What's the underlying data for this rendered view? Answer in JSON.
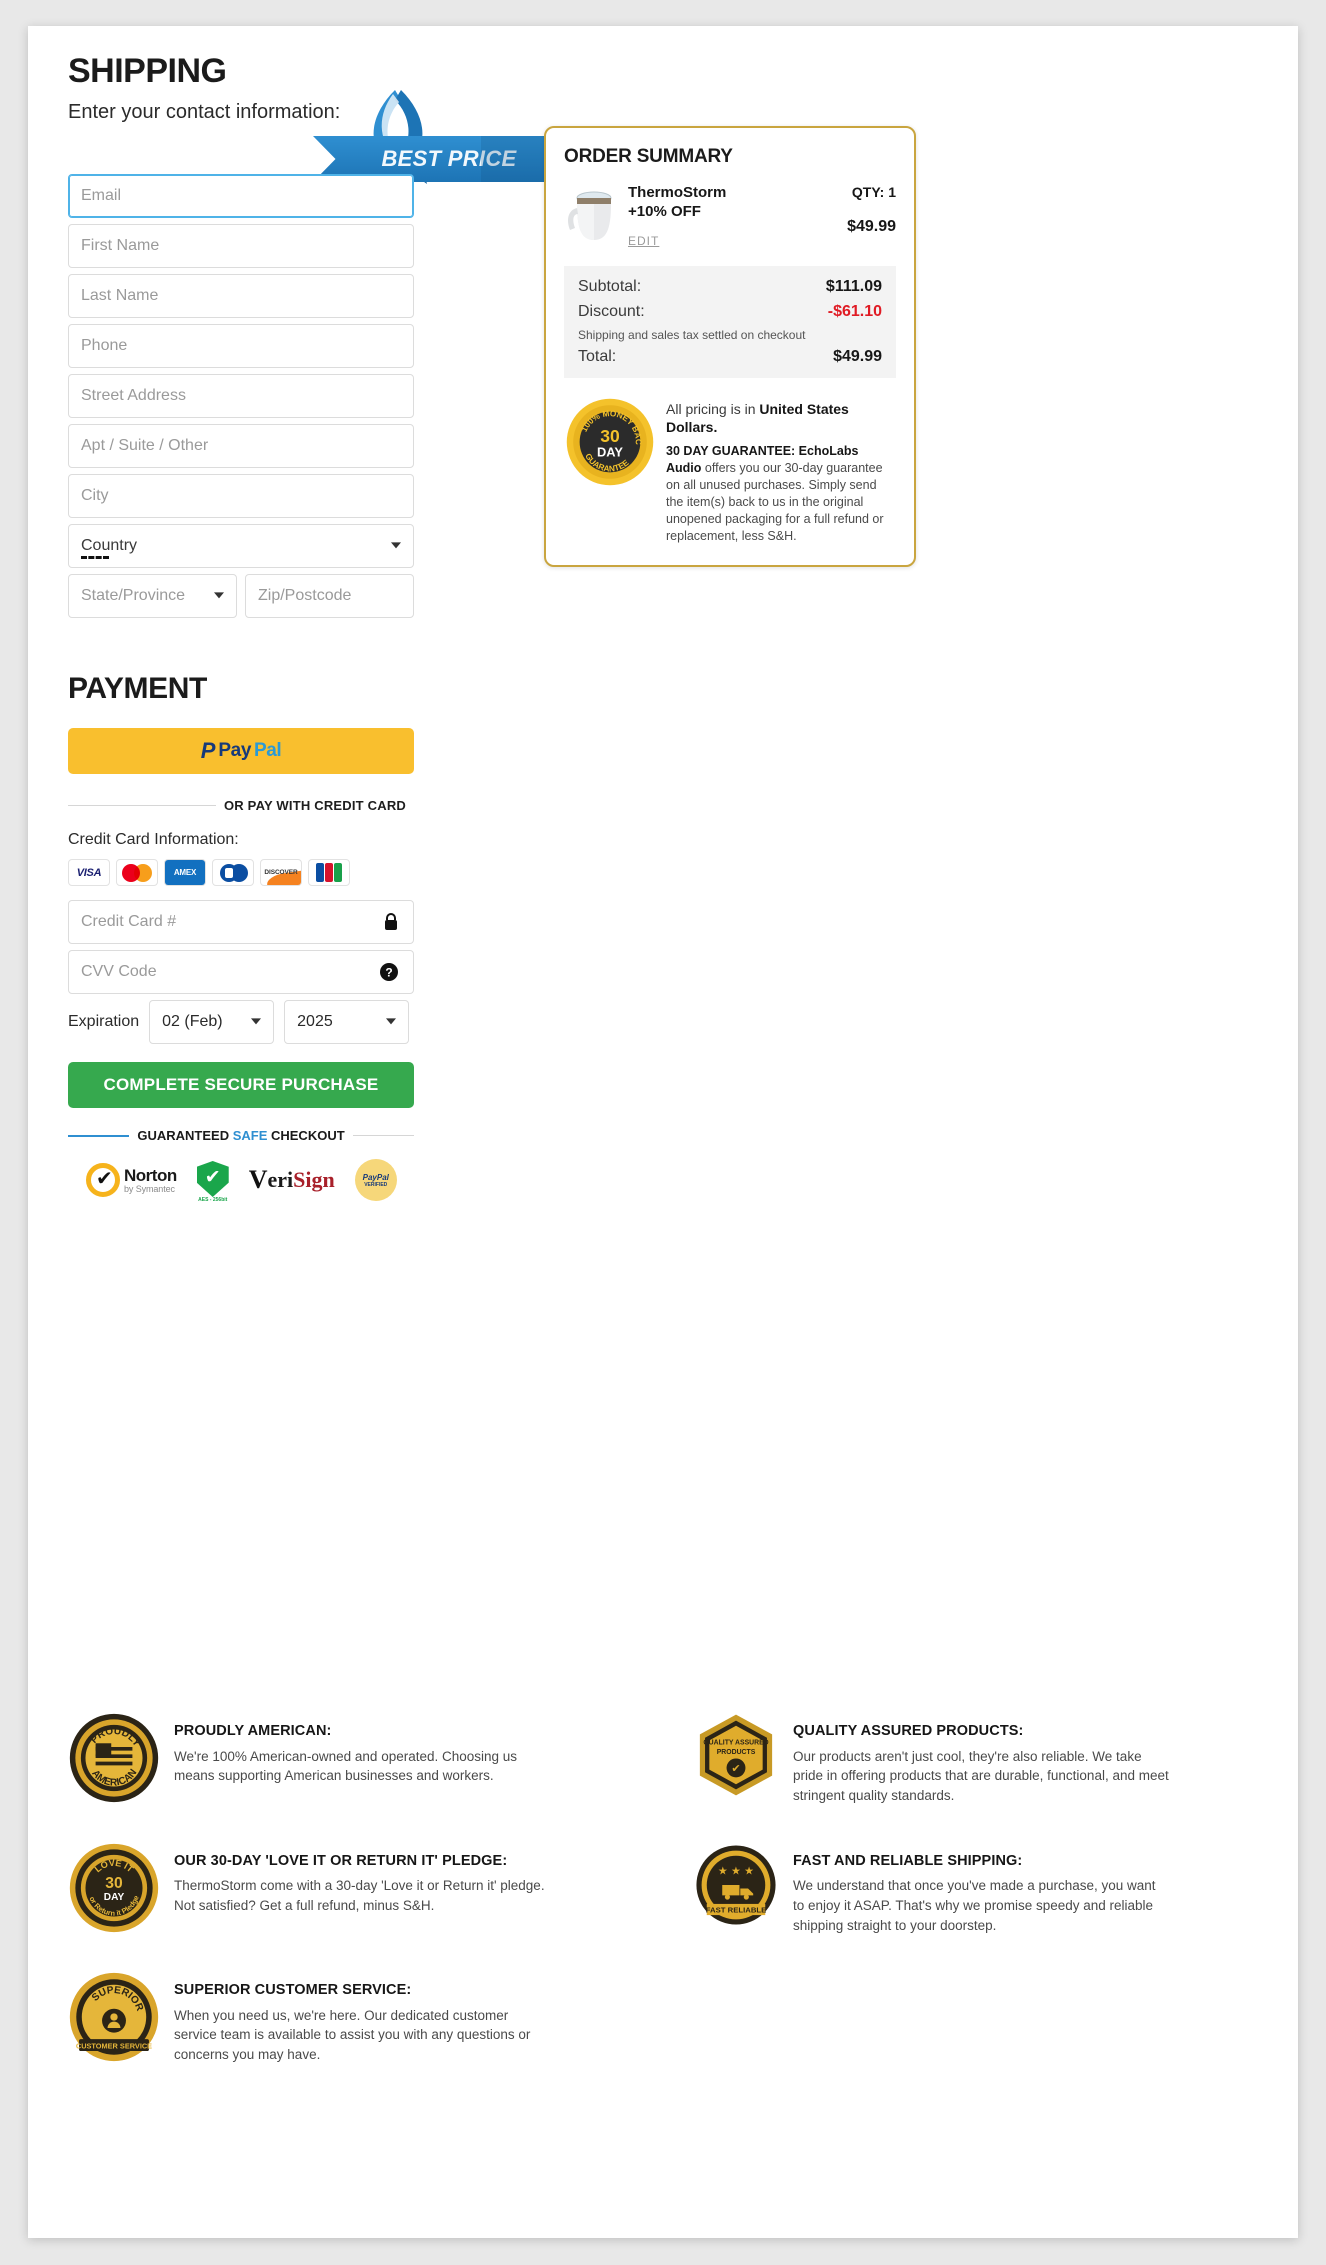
{
  "shipping": {
    "heading": "SHIPPING",
    "subtitle": "Enter your contact information:",
    "ribbon_label": "BEST PRICE",
    "fields": [
      {
        "name": "email",
        "placeholder": "Email",
        "type": "text",
        "focused": true
      },
      {
        "name": "first-name",
        "placeholder": "First Name",
        "type": "text"
      },
      {
        "name": "last-name",
        "placeholder": "Last Name",
        "type": "text"
      },
      {
        "name": "phone",
        "placeholder": "Phone",
        "type": "text"
      },
      {
        "name": "street-address",
        "placeholder": "Street Address",
        "type": "text"
      },
      {
        "name": "apt-suite",
        "placeholder": "Apt / Suite / Other",
        "type": "text"
      },
      {
        "name": "city",
        "placeholder": "City",
        "type": "text"
      },
      {
        "name": "country",
        "placeholder": "Country",
        "type": "select"
      },
      {
        "name": "state-province",
        "placeholder": "State/Province",
        "type": "select"
      },
      {
        "name": "zip-postcode",
        "placeholder": "Zip/Postcode",
        "type": "text"
      }
    ]
  },
  "payment": {
    "heading": "PAYMENT",
    "paypal": {
      "p": "P",
      "pay": "Pay",
      "pal": "Pal"
    },
    "or_divider": "OR PAY WITH CREDIT CARD",
    "cc_label": "Credit Card Information:",
    "card_icons": [
      "visa-icon",
      "mastercard-icon",
      "amex-icon",
      "diners-club-icon",
      "discover-icon",
      "jcb-icon"
    ],
    "card_icon_labels": {
      "visa": "VISA",
      "amex": "AMEX",
      "discover": "DISCOVER"
    },
    "cc_number_placeholder": "Credit Card #",
    "cvv_placeholder": "CVV Code",
    "expiration_label": "Expiration",
    "expiration_month": "02 (Feb)",
    "expiration_year": "2025",
    "submit_label": "COMPLETE SECURE PURCHASE",
    "safe_checkout": {
      "pre": "GUARANTEED ",
      "highlight": "SAFE",
      "post": " CHECKOUT"
    },
    "trust_badges": {
      "norton_name": "Norton",
      "norton_sub": "by Symantec",
      "shield_caption": "AES - 256bit",
      "verisign_v": "V",
      "verisign_eri": "eri",
      "verisign_sign": "Sign",
      "paypal_badge_1": "PayPal",
      "paypal_badge_2": "VERIFIED"
    }
  },
  "order_summary": {
    "title": "ORDER SUMMARY",
    "item": {
      "name": "ThermoStorm",
      "discount_line": "+10% OFF",
      "edit_label": "EDIT",
      "qty_label": "QTY: 1",
      "price": "$49.99",
      "thumb_icon": "product-thumbnail-mug"
    },
    "totals": [
      {
        "label": "Subtotal:",
        "amount": "$111.09",
        "negative": false
      },
      {
        "label": "Discount:",
        "amount": "-$61.10",
        "negative": true
      }
    ],
    "note": "Shipping and sales tax settled on checkout",
    "total": {
      "label": "Total:",
      "amount": "$49.99"
    },
    "guarantee": {
      "badge_icon": "money-back-guarantee-badge",
      "badge_text_top": "100% MONEY BACK",
      "badge_text_center_1": "30",
      "badge_text_center_2": "DAY",
      "badge_text_bottom": "GUARANTEE",
      "currency_lead_plain": "All pricing is in ",
      "currency_lead_bold": "United States Dollars.",
      "body_bold": "30 DAY GUARANTEE: EchoLabs Audio",
      "body_rest": " offers you our 30-day guarantee on all unused purchases. Simply send the item(s) back to us in the original unopened packaging for a full refund or replacement, less S&H."
    }
  },
  "features": [
    {
      "badge": "proudly-american-badge",
      "badge_top": "PROUDLY",
      "badge_bottom": "AMERICAN",
      "title": "PROUDLY AMERICAN:",
      "body": "We're 100% American-owned and operated. Choosing us means supporting American businesses and workers."
    },
    {
      "badge": "quality-assured-badge",
      "badge_top": "QUALITY ASSURED",
      "badge_bottom": "PRODUCTS",
      "title": "QUALITY ASSURED PRODUCTS:",
      "body": "Our products aren't just cool, they're also reliable. We take pride in offering products that are durable, functional, and meet stringent quality standards."
    },
    {
      "badge": "love-it-or-return-it-badge",
      "badge_top": "LOVE IT",
      "badge_center": "30 DAY",
      "badge_bottom": "or Return it Pledge",
      "title": "OUR 30-DAY 'LOVE IT OR RETURN IT' PLEDGE:",
      "body": "ThermoStorm come with a 30-day 'Love it or Return it' pledge. Not satisfied? Get a full refund, minus S&H."
    },
    {
      "badge": "fast-reliable-shipping-badge",
      "badge_top": "★ ★ ★",
      "badge_bottom": "FAST RELIABLE",
      "title": "FAST AND RELIABLE SHIPPING:",
      "body": "We understand that once you've made a purchase, you want to enjoy it ASAP. That's why we promise speedy and reliable shipping straight to your doorstep."
    },
    {
      "badge": "superior-customer-service-badge",
      "badge_top": "SUPERIOR",
      "badge_bottom": "CUSTOMER SERVICE",
      "title": "SUPERIOR CUSTOMER SERVICE:",
      "body": "When you need us, we're here. Our dedicated customer service team is available to assist you with any questions or concerns you may have."
    }
  ],
  "colors": {
    "accent_blue": "#2f8fd1",
    "gold_border": "#c9a53f",
    "green_cta": "#36a94e",
    "paypal_yellow": "#f9bf2e",
    "discount_red": "#e01b24"
  }
}
